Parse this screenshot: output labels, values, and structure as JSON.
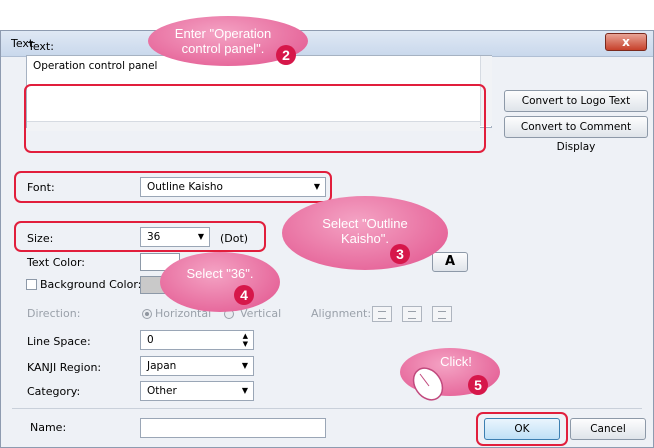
{
  "dialog": {
    "title": "Text",
    "close_glyph": "x"
  },
  "text_section": {
    "label": "Text:",
    "value": "Operation control panel"
  },
  "buttons": {
    "logo": "Convert to Logo Text",
    "comment": "Convert to Comment Display",
    "ok": "OK",
    "cancel": "Cancel"
  },
  "font": {
    "label": "Font:",
    "value": "Outline Kaisho"
  },
  "size": {
    "label": "Size:",
    "value": "36",
    "unit": "(Dot)"
  },
  "text_color": {
    "label": "Text Color:"
  },
  "background_color": {
    "label": "Background Color:",
    "checked": false
  },
  "direction": {
    "label": "Direction:",
    "horizontal": "Horizontal",
    "vertical": "Vertical"
  },
  "alignment": {
    "label": "Alignment:"
  },
  "line_space": {
    "label": "Line Space:",
    "value": "0"
  },
  "kanji_region": {
    "label": "KANJI Region:",
    "value": "Japan"
  },
  "category": {
    "label": "Category:",
    "value": "Other"
  },
  "name": {
    "label": "Name:",
    "value": ""
  },
  "callouts": {
    "step2": "Enter \"Operation control panel\".",
    "step3": "Select \"Outline Kaisho\".",
    "step4": "Select \"36\".",
    "step5": "Click!"
  },
  "step_numbers": {
    "n2": "2",
    "n3": "3",
    "n4": "4",
    "n5": "5"
  },
  "bold_glyph": "A",
  "icons": [
    "close-icon",
    "dropdown-arrow-icon",
    "spinner-icon",
    "mouse-icon"
  ],
  "colors": {
    "highlight": "#e11e3c",
    "callout": "#e6669a",
    "step_number": "#d6174a"
  }
}
